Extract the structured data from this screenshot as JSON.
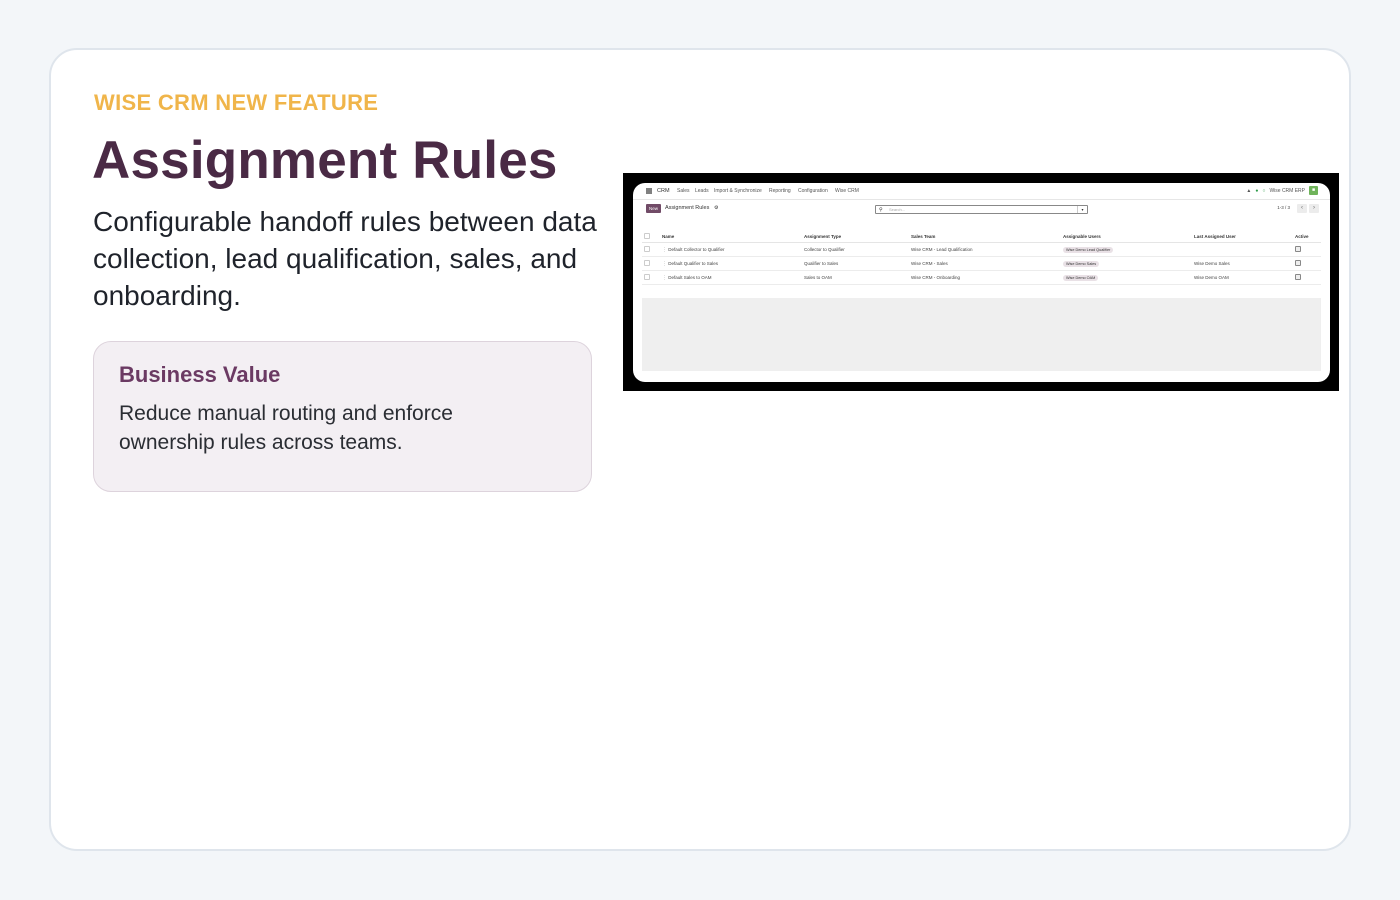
{
  "eyebrow": "WISE CRM NEW FEATURE",
  "title": "Assignment Rules",
  "subtitle": "Configurable handoff rules between data collection, lead qualification, sales, and onboarding.",
  "value_box": {
    "title": "Business Value",
    "text": "Reduce manual routing and enforce ownership rules across teams."
  },
  "app": {
    "nav": [
      "CRM",
      "Sales",
      "Leads",
      "Import & Synchronize",
      "Reporting",
      "Configuration",
      "Wise CRM"
    ],
    "company": "Wise CRM ERP",
    "new_button": "New",
    "breadcrumb": "Assignment Rules",
    "search_placeholder": "Search...",
    "pager": "1-3 / 3",
    "columns": [
      "Name",
      "Assignment Type",
      "Sales Team",
      "Assignable Users",
      "Last Assigned User",
      "Active"
    ],
    "rows": [
      {
        "name": "Default Collector to Qualifier",
        "type": "Collector to Qualifier",
        "team": "Wise CRM - Lead Qualification",
        "users": "Wise Demo Lead Qualifier",
        "last": ""
      },
      {
        "name": "Default Qualifier to Sales",
        "type": "Qualifier to Sales",
        "team": "Wise CRM - Sales",
        "users": "Wise Demo Sales",
        "last": "Wise Demo Sales"
      },
      {
        "name": "Default Sales to OAM",
        "type": "Sales to OAM",
        "team": "Wise CRM - Onboarding",
        "users": "Wise Demo OAM",
        "last": "Wise Demo OAM"
      }
    ]
  },
  "colors": {
    "eyebrow": "#f0b54a",
    "title": "#4a2a45",
    "accent": "#714b67"
  }
}
